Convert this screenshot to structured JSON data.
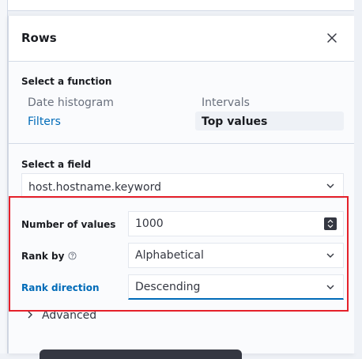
{
  "panel": {
    "title": "Rows"
  },
  "function_section": {
    "label": "Select a function",
    "options": {
      "date_histogram": "Date histogram",
      "intervals": "Intervals",
      "filters": "Filters",
      "top_values": "Top values"
    },
    "selected": "Top values"
  },
  "field_section": {
    "label": "Select a field",
    "value": "host.hostname.keyword"
  },
  "number_of_values": {
    "label": "Number of values",
    "value": "1000"
  },
  "rank_by": {
    "label": "Rank by",
    "value": "Alphabetical"
  },
  "rank_direction": {
    "label": "Rank direction",
    "value": "Descending"
  },
  "advanced": {
    "label": "Advanced"
  },
  "colors": {
    "accent": "#006bb8",
    "highlight": "#e5202a"
  }
}
